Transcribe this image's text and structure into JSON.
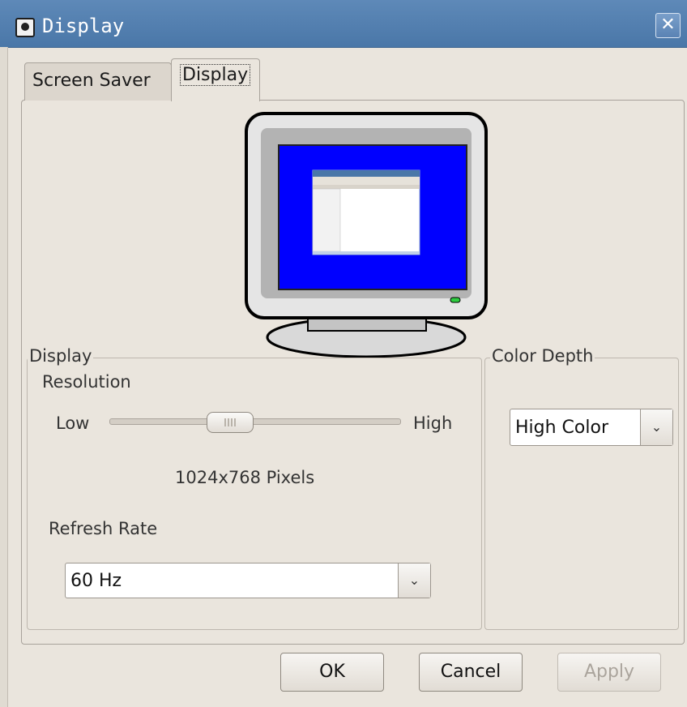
{
  "window": {
    "title": "Display",
    "title_icon": "app-icon",
    "close_icon": "close-icon"
  },
  "tabs": [
    {
      "label": "Screen Saver",
      "selected": false
    },
    {
      "label": "Display",
      "selected": true
    }
  ],
  "display_group": {
    "legend": "Display",
    "resolution_label": "Resolution",
    "slider_low": "Low",
    "slider_high": "High",
    "resolution_value": "1024x768 Pixels",
    "refresh_label": "Refresh Rate",
    "refresh_value": "60 Hz"
  },
  "color_group": {
    "legend": "Color Depth",
    "value": "High Color"
  },
  "buttons": {
    "ok": "OK",
    "cancel": "Cancel",
    "apply": "Apply"
  },
  "colors": {
    "titlebar": "#4a77a8",
    "dialog_bg": "#eae5dd",
    "monitor_screen": "#0000ff"
  }
}
